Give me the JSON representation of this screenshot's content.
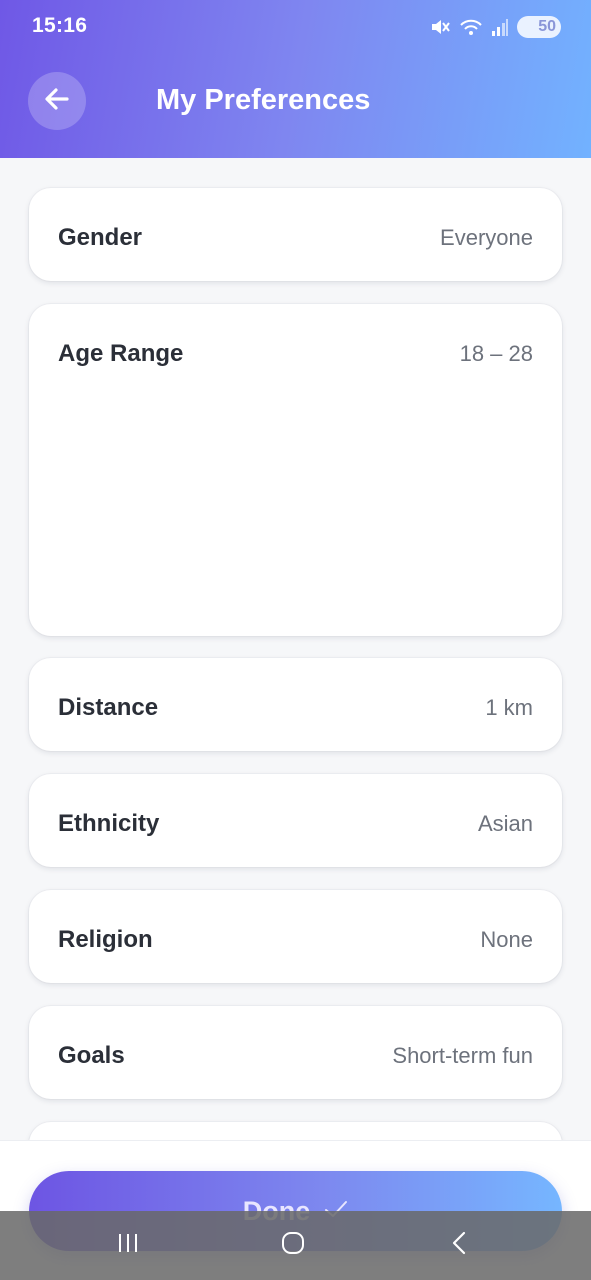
{
  "status_bar": {
    "time": "15:16",
    "battery": "50",
    "icons": [
      "mute-icon",
      "wifi-icon",
      "signal-icon",
      "battery-icon"
    ]
  },
  "header": {
    "title": "My Preferences",
    "back_icon": "arrow-left-icon"
  },
  "preferences": [
    {
      "label": "Gender",
      "value": "Everyone"
    },
    {
      "label": "Age Range",
      "value": "18 – 28"
    },
    {
      "label": "Distance",
      "value": "1 km"
    },
    {
      "label": "Ethnicity",
      "value": "Asian"
    },
    {
      "label": "Religion",
      "value": "None"
    },
    {
      "label": "Goals",
      "value": "Short-term fun"
    }
  ],
  "footer": {
    "done_label": "Done",
    "done_icon": "checkmark-icon"
  },
  "nav_bar": {
    "icons": [
      "recent-apps-icon",
      "home-icon",
      "back-icon"
    ]
  },
  "colors": {
    "header_gradient_start": "#6f58e6",
    "header_gradient_end": "#72b2ff",
    "background": "#f6f7f9",
    "card": "#ffffff",
    "label_text": "#2b2f38",
    "value_text": "#6d727c"
  }
}
